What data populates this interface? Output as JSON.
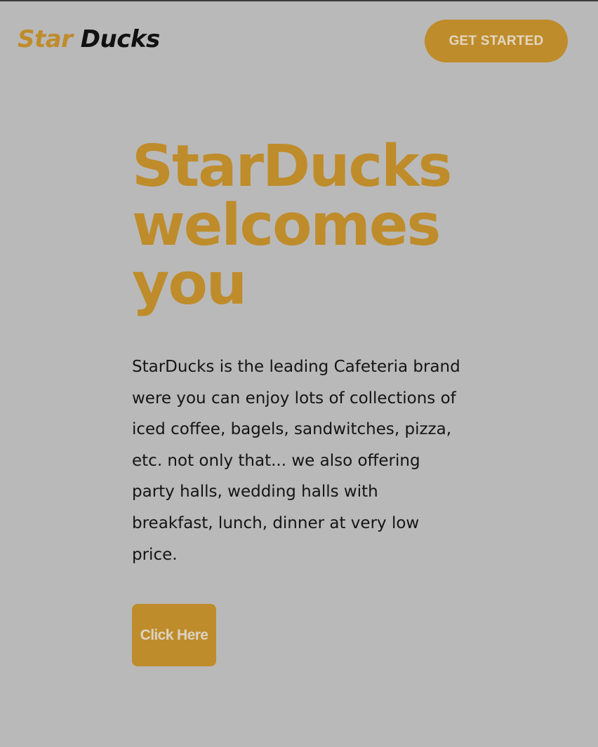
{
  "header": {
    "logo_part1": "Star",
    "logo_part2": "Ducks",
    "cta_label": "GET STARTED"
  },
  "hero": {
    "title_line1": "StarDucks",
    "title_line2": "welcomes",
    "title_line3": "you",
    "description": "StarDucks is the leading Cafeteria brand were you can enjoy lots of collections of iced coffee, bagels, sandwitches, pizza, etc. not only that... we also offering party halls, wedding halls with breakfast, lunch, dinner at very low price.",
    "button_label": "Click Here"
  },
  "colors": {
    "background": "#b9b9b9",
    "accent": "#bf8c2b",
    "text": "#141414"
  }
}
